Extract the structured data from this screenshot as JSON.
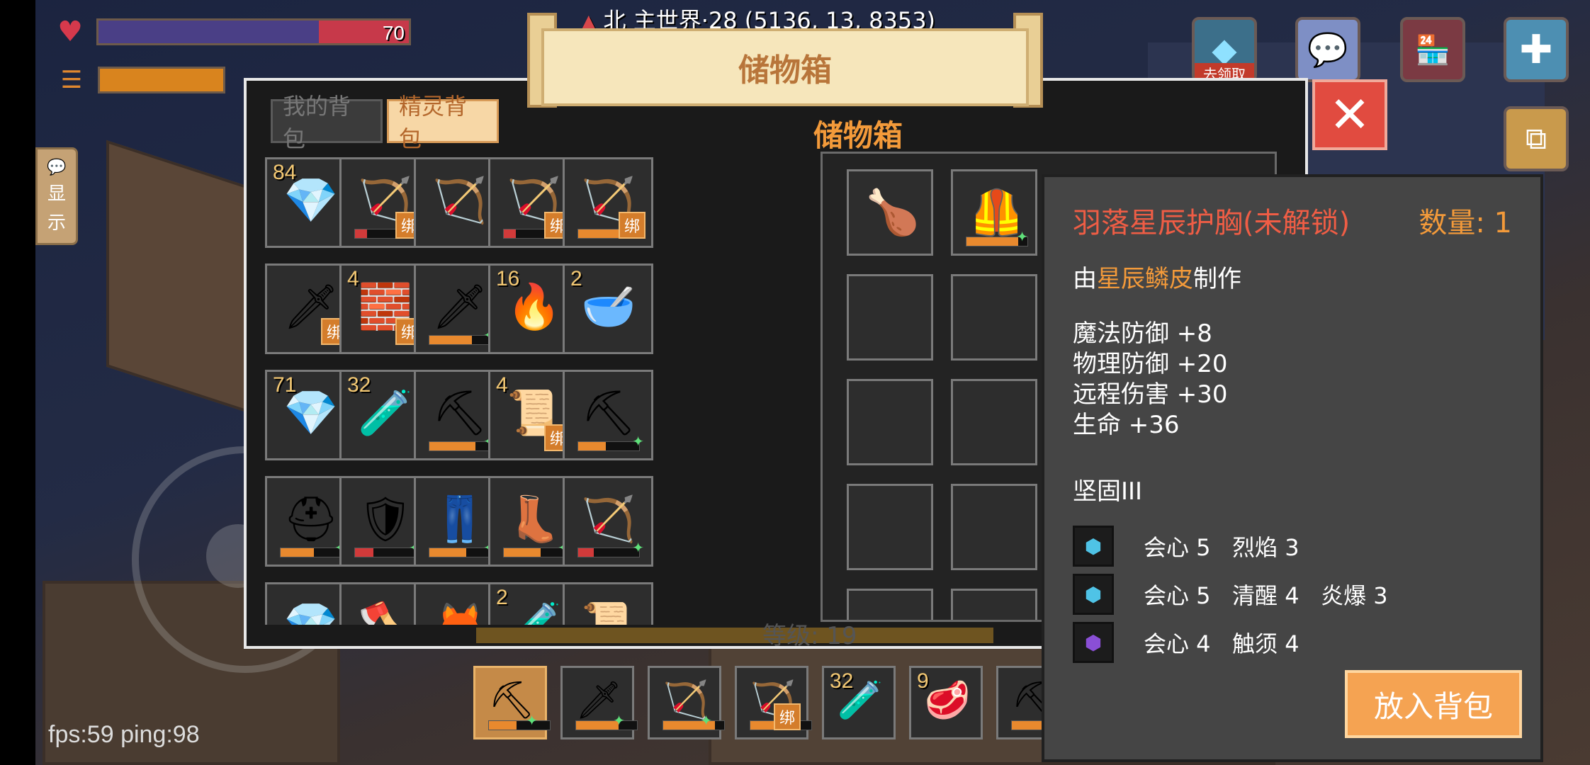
{
  "hud": {
    "health_value": "70",
    "health_fraction": 0.71,
    "hunger_fraction": 1.0,
    "coordinates": "北  主世界·28 (5136, 13, 8353)",
    "fps": "fps:59 ping:98",
    "side_tab_chars": [
      "显",
      "示"
    ],
    "top_buttons": [
      {
        "name": "gem-shop",
        "label": "去领取",
        "icon": "diamond-icon"
      },
      {
        "name": "chat",
        "label": "",
        "icon": "chat-icon"
      },
      {
        "name": "shop",
        "label": "",
        "icon": "store-icon"
      },
      {
        "name": "add",
        "label": "",
        "icon": "plus-icon"
      },
      {
        "name": "build",
        "label": "",
        "icon": "cubes-icon"
      }
    ],
    "level_label": "等级: 19"
  },
  "storage": {
    "banner_title": "储物箱",
    "tabs": [
      {
        "label": "我的背包",
        "active": false
      },
      {
        "label": "精灵背包",
        "active": true
      }
    ],
    "chest_title": "储物箱",
    "close_icon": "close-icon"
  },
  "inventory": [
    {
      "icon": "💎",
      "name": "pink-gem",
      "count": "84",
      "bind": "",
      "dur": null
    },
    {
      "icon": "🏹",
      "name": "ice-bow",
      "count": "",
      "bind": "绑",
      "dur": 0.2
    },
    {
      "icon": "🏹",
      "name": "ice-bow-2",
      "count": "",
      "bind": "",
      "dur": null
    },
    {
      "icon": "🏹",
      "name": "golden-bow",
      "count": "",
      "bind": "绑",
      "dur": 0.2
    },
    {
      "icon": "🏹",
      "name": "dark-bow",
      "count": "",
      "bind": "绑",
      "dur": 0.75
    },
    {
      "icon": "🗡",
      "name": "red-blade",
      "count": "",
      "bind": "绑",
      "dur": null
    },
    {
      "icon": "🧱",
      "name": "copper-ingot",
      "count": "4",
      "bind": "绑",
      "dur": null
    },
    {
      "icon": "🗡",
      "name": "dark-sword",
      "count": "",
      "bind": "",
      "dur": 0.7
    },
    {
      "icon": "🔥",
      "name": "torch",
      "count": "16",
      "bind": "",
      "dur": null
    },
    {
      "icon": "🥣",
      "name": "soup-bowl",
      "count": "2",
      "bind": "",
      "dur": null
    },
    {
      "icon": "💎",
      "name": "blue-gem",
      "count": "71",
      "bind": "",
      "dur": null
    },
    {
      "icon": "🧪",
      "name": "red-potion",
      "count": "32",
      "bind": "",
      "dur": null
    },
    {
      "icon": "⛏",
      "name": "crystal-pickaxe",
      "count": "",
      "bind": "",
      "dur": 0.75
    },
    {
      "icon": "📜",
      "name": "golden-material",
      "count": "4",
      "bind": "绑",
      "dur": null
    },
    {
      "icon": "⛏",
      "name": "dark-pickaxe",
      "count": "",
      "bind": "",
      "dur": 0.45
    },
    {
      "icon": "⛑",
      "name": "helmet",
      "count": "",
      "bind": "",
      "dur": 0.55
    },
    {
      "icon": "🛡",
      "name": "chest-armor",
      "count": "",
      "bind": "",
      "dur": 0.3
    },
    {
      "icon": "👖",
      "name": "leg-armor",
      "count": "",
      "bind": "",
      "dur": 0.6
    },
    {
      "icon": "👢",
      "name": "boots",
      "count": "",
      "bind": "",
      "dur": 0.6
    },
    {
      "icon": "🏹",
      "name": "quiver",
      "count": "",
      "bind": "",
      "dur": 0.25
    },
    {
      "icon": "💎",
      "name": "crystal-shard",
      "count": "",
      "bind": "",
      "dur": null
    },
    {
      "icon": "🪓",
      "name": "crystal-axe",
      "count": "",
      "bind": "",
      "dur": null
    },
    {
      "icon": "🦊",
      "name": "orange-item",
      "count": "",
      "bind": "",
      "dur": null
    },
    {
      "icon": "🧪",
      "name": "bottle",
      "count": "2",
      "bind": "",
      "dur": null
    },
    {
      "icon": "📜",
      "name": "scroll",
      "count": "",
      "bind": "",
      "dur": null
    }
  ],
  "chest": [
    {
      "icon": "🍗",
      "name": "roast-chicken",
      "dur": null
    },
    {
      "icon": "🦺",
      "name": "star-chestplate",
      "dur": 0.85
    },
    {
      "icon": "",
      "name": "empty",
      "dur": null
    },
    {
      "icon": "",
      "name": "empty",
      "dur": null
    }
  ],
  "hotbar": [
    {
      "icon": "⛏",
      "name": "dark-pickaxe",
      "count": "",
      "bind": "",
      "dur": 0.45,
      "selected": true
    },
    {
      "icon": "🗡",
      "name": "dark-sword",
      "count": "",
      "bind": "",
      "dur": 0.7,
      "selected": false
    },
    {
      "icon": "🏹",
      "name": "ice-bow",
      "count": "",
      "bind": "",
      "dur": 0.85,
      "selected": false
    },
    {
      "icon": "🏹",
      "name": "dark-bow",
      "count": "",
      "bind": "绑",
      "dur": 0.75,
      "selected": false
    },
    {
      "icon": "🧪",
      "name": "red-potion",
      "count": "32",
      "bind": "",
      "dur": null,
      "selected": false
    },
    {
      "icon": "🥩",
      "name": "meat",
      "count": "9",
      "bind": "",
      "dur": null,
      "selected": false
    },
    {
      "icon": "⛏",
      "name": "crystal-pickaxe",
      "count": "",
      "bind": "",
      "dur": 0.75,
      "selected": false
    }
  ],
  "tooltip": {
    "name": "羽落星辰护胸(未解锁)",
    "quantity": "数量: 1",
    "made_prefix": "由",
    "made_material": "星辰鳞皮",
    "made_suffix": "制作",
    "stats": [
      "魔法防御 +8",
      "物理防御 +20",
      "远程伤害 +30",
      "生命 +36"
    ],
    "enchant": "坚固III",
    "gems": [
      {
        "icon": "⬢",
        "color": "#4fc3e6",
        "text": "会心 5   烈焰 3"
      },
      {
        "icon": "⬢",
        "color": "#4fc3e6",
        "text": "会心 5   清醒 4   炎爆 3"
      },
      {
        "icon": "⬢",
        "color": "#8a4fd6",
        "text": "会心 4   触须 4"
      }
    ],
    "put_button": "放入背包"
  },
  "colors": {
    "accent_orange": "#f39a3a",
    "item_name_red": "#ef5d45",
    "close_red": "#e14b40",
    "durability_orange": "#e8892e",
    "durability_red": "#d23a3a"
  }
}
